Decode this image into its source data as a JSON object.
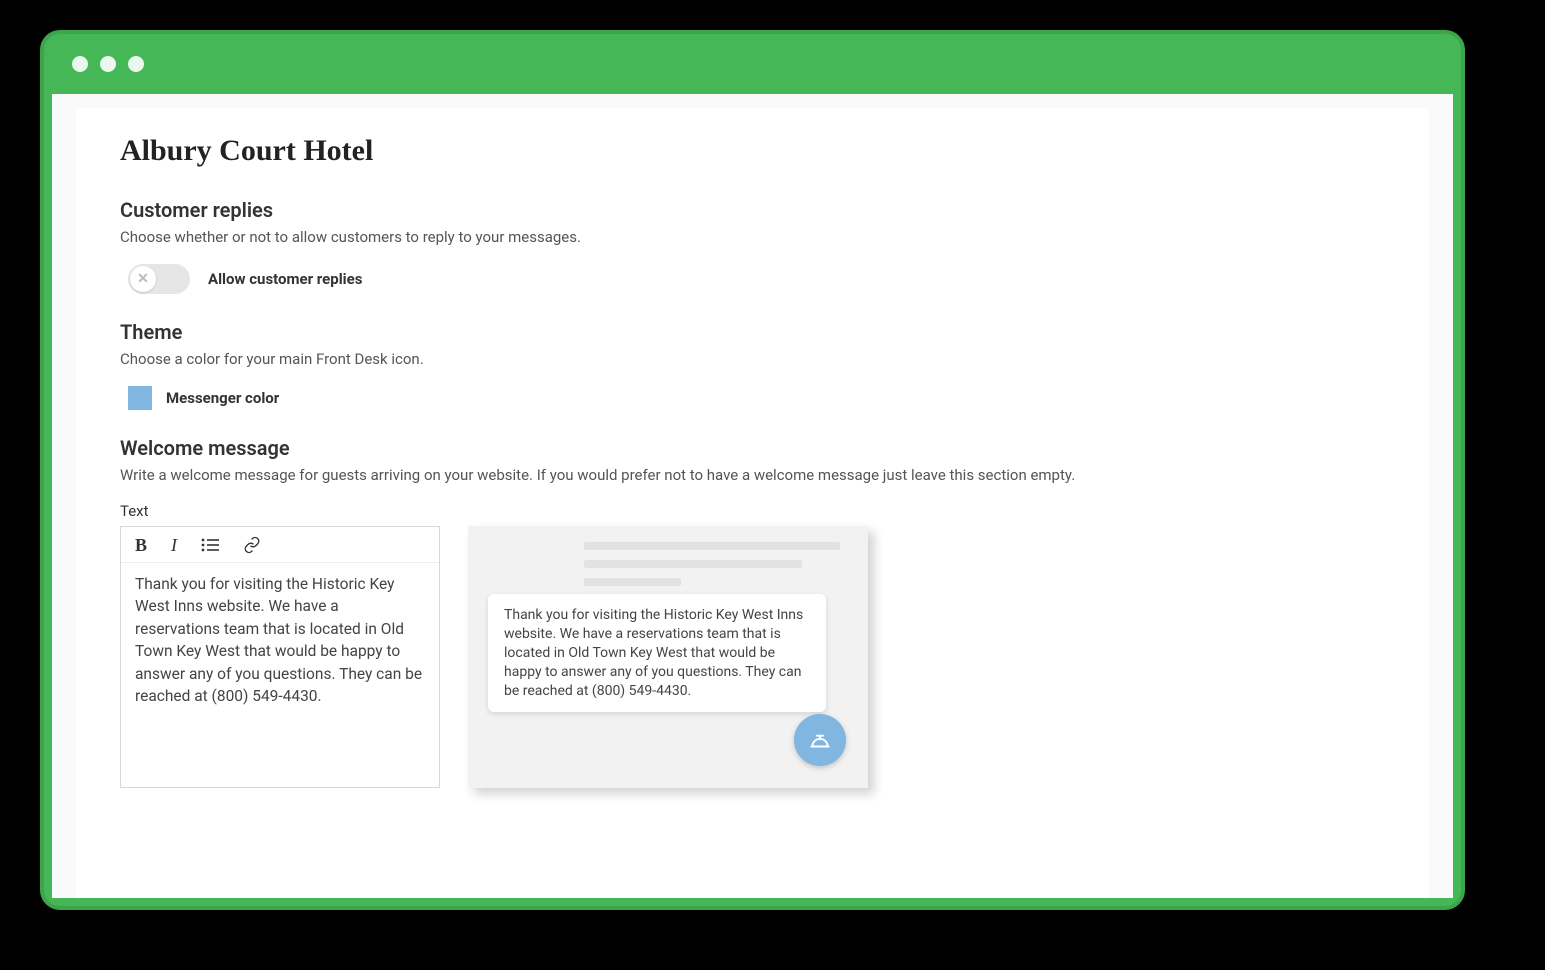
{
  "page_title": "Albury Court Hotel",
  "customer_replies": {
    "heading": "Customer replies",
    "description": "Choose whether or not to allow customers to reply to your messages.",
    "toggle_label": "Allow customer replies",
    "toggle_state": "off",
    "toggle_icon": "✕"
  },
  "theme": {
    "heading": "Theme",
    "description": "Choose a color for your main Front Desk icon.",
    "color_label": "Messenger color",
    "color_value": "#80b6e0"
  },
  "welcome": {
    "heading": "Welcome message",
    "description": "Write a welcome message for guests arriving on your website. If you would prefer not to have a welcome message just leave this section empty.",
    "field_label": "Text",
    "editor_text": "Thank you for visiting the Historic Key West Inns website. We have a reservations team that is located in Old Town Key West that would be happy to answer any of you questions. They can be reached at (800) 549-4430.",
    "preview_text": "Thank you for visiting the Historic Key West Inns website. We have a reservations team that is located in Old Town Key West that would be happy to answer any of you questions. They can be reached at (800) 549-4430."
  },
  "toolbar_icons": {
    "bold": "B",
    "italic": "I"
  }
}
